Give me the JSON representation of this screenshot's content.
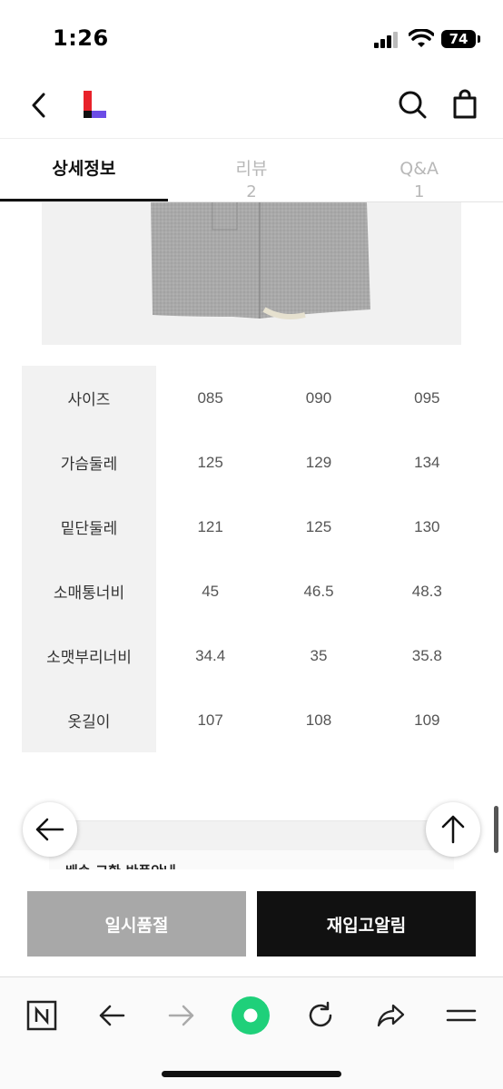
{
  "status_bar": {
    "time": "1:26",
    "battery": "74"
  },
  "header": {
    "back": "back",
    "logo": "L"
  },
  "tabs": [
    {
      "label": "상세정보",
      "count": ""
    },
    {
      "label": "리뷰",
      "count": "2"
    },
    {
      "label": "Q&A",
      "count": "1"
    }
  ],
  "size_table": {
    "rows": [
      {
        "label": "사이즈",
        "values": [
          "085",
          "090",
          "095"
        ]
      },
      {
        "label": "가슴둘레",
        "values": [
          "125",
          "129",
          "134"
        ]
      },
      {
        "label": "밑단둘레",
        "values": [
          "121",
          "125",
          "130"
        ]
      },
      {
        "label": "소매통너비",
        "values": [
          "45",
          "46.5",
          "48.3"
        ]
      },
      {
        "label": "소맷부리너비",
        "values": [
          "34.4",
          "35",
          "35.8"
        ]
      },
      {
        "label": "옷길이",
        "values": [
          "107",
          "108",
          "109"
        ]
      }
    ]
  },
  "info_box": {
    "text": "배송·교환·반품안내"
  },
  "actions": {
    "soldout_label": "일시품절",
    "restock_label": "재입고알림"
  },
  "colors": {
    "accent_red": "#e8222a",
    "accent_purple": "#6b4ce6",
    "green": "#1fd07a"
  }
}
